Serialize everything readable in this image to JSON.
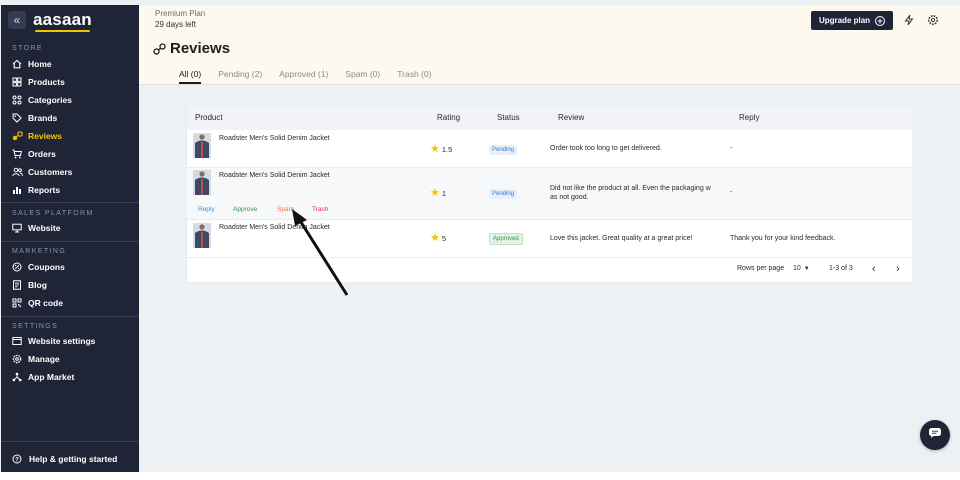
{
  "sidebar": {
    "logo": "aasaan",
    "collapse_icon": "«",
    "sections": {
      "store": "STORE",
      "sales_platform": "SALES PLATFORM",
      "marketing": "MARKETING",
      "settings": "SETTINGS"
    },
    "items": [
      {
        "label": "Home",
        "icon": "home-icon"
      },
      {
        "label": "Products",
        "icon": "box-icon"
      },
      {
        "label": "Categories",
        "icon": "grid-icon"
      },
      {
        "label": "Brands",
        "icon": "tag-icon"
      },
      {
        "label": "Reviews",
        "icon": "reviews-icon",
        "active": true
      },
      {
        "label": "Orders",
        "icon": "cart-icon"
      },
      {
        "label": "Customers",
        "icon": "users-icon"
      },
      {
        "label": "Reports",
        "icon": "bar-chart-icon"
      },
      {
        "label": "Website",
        "icon": "monitor-icon"
      },
      {
        "label": "Coupons",
        "icon": "coupon-icon"
      },
      {
        "label": "Blog",
        "icon": "document-icon"
      },
      {
        "label": "QR code",
        "icon": "qr-icon"
      },
      {
        "label": "Website settings",
        "icon": "settings-panel-icon"
      },
      {
        "label": "Manage",
        "icon": "gear-icon"
      },
      {
        "label": "App Market",
        "icon": "app-market-icon"
      }
    ],
    "help": "Help & getting started"
  },
  "header": {
    "plan_name": "Premium Plan",
    "plan_days": "29 days left",
    "upgrade_label": "Upgrade plan",
    "page_title": "Reviews",
    "tabs": [
      {
        "label": "All (0)",
        "active": true
      },
      {
        "label": "Pending (2)"
      },
      {
        "label": "Approved (1)"
      },
      {
        "label": "Spam (0)"
      },
      {
        "label": "Trash (0)"
      }
    ]
  },
  "table": {
    "columns": [
      "Product",
      "Rating",
      "Status",
      "Review",
      "Reply"
    ],
    "rows": [
      {
        "product": "Roadster Men's Solid Denim Jacket",
        "rating": "1.5",
        "status": "Pending",
        "review": "Order took too long to get delivered.",
        "reply": "-"
      },
      {
        "product": "Roadster Men's Solid Denim Jacket",
        "rating": "1",
        "status": "Pending",
        "review_line1": "Did not like the product at all. Even the packaging w",
        "review_line2": "as not good.",
        "reply": "-"
      },
      {
        "product": "Roadster Men's Solid Denim Jacket",
        "rating": "5",
        "status": "Approved",
        "review": "Love this jacket. Great quality at a great price!",
        "reply": "Thank you for your kind feedback."
      }
    ],
    "row_actions": {
      "reply": "Reply",
      "approve": "Approve",
      "spam": "Spam",
      "trash": "Trash"
    },
    "pagination": {
      "rows_per_page_label": "Rows per page",
      "rows_per_page": "10",
      "range": "1-3 of 3"
    }
  },
  "colors": {
    "accent": "#f5c400",
    "sidebar": "#1f2536",
    "reply": "#3a8fd6",
    "approve": "#2e9446",
    "spam": "#e8703a",
    "trash": "#d9363e"
  }
}
